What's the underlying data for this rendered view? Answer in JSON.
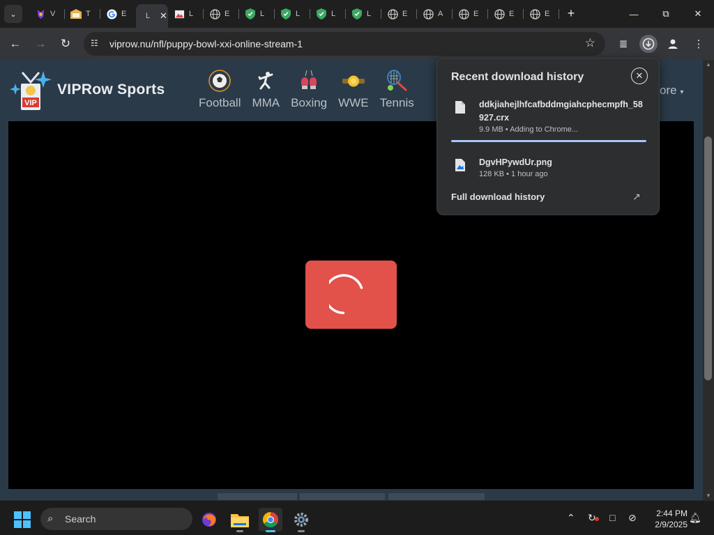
{
  "browser": {
    "tabs": [
      {
        "favicon": "purple-app-icon",
        "color": "#7b3fe4",
        "label": "V"
      },
      {
        "favicon": "gold-folder-icon",
        "color": "#e7b35b",
        "label": "T"
      },
      {
        "favicon": "google-icon",
        "color": "#ffffff",
        "label": "E"
      },
      {
        "favicon": "blank-tab-icon",
        "color": "#35363a",
        "label": "L",
        "active": true
      },
      {
        "favicon": "image-icon",
        "color": "#d44",
        "label": "L"
      },
      {
        "favicon": "globe-icon",
        "color": "#c4c7c5",
        "label": "E"
      },
      {
        "favicon": "shield-icon",
        "color": "#3da861",
        "label": "L"
      },
      {
        "favicon": "shield-icon",
        "color": "#3da861",
        "label": "L"
      },
      {
        "favicon": "shield-icon",
        "color": "#3da861",
        "label": "L"
      },
      {
        "favicon": "shield-icon",
        "color": "#3da861",
        "label": "L"
      },
      {
        "favicon": "globe-icon",
        "color": "#c4c7c5",
        "label": "E"
      },
      {
        "favicon": "globe-icon",
        "color": "#c4c7c5",
        "label": "A"
      },
      {
        "favicon": "globe-icon",
        "color": "#c4c7c5",
        "label": "E"
      },
      {
        "favicon": "globe-icon",
        "color": "#c4c7c5",
        "label": "E"
      },
      {
        "favicon": "globe-icon",
        "color": "#c4c7c5",
        "label": "E"
      }
    ],
    "url": "viprow.nu/nfl/puppy-bowl-xxi-online-stream-1"
  },
  "site": {
    "brand": "VIPRow Sports",
    "nav": [
      {
        "label": "Football",
        "icon": "football-icon"
      },
      {
        "label": "MMA",
        "icon": "fighter-icon"
      },
      {
        "label": "Boxing",
        "icon": "boxing-gloves-icon"
      },
      {
        "label": "WWE",
        "icon": "championship-belt-icon"
      },
      {
        "label": "Tennis",
        "icon": "tennis-icon"
      }
    ],
    "more_label": "ore"
  },
  "downloads": {
    "title": "Recent download history",
    "items": [
      {
        "name": "ddkjiahejlhfcafbddmgiahcphecmpfh_58927.crx",
        "meta": "9.9 MB • Adding to Chrome..."
      },
      {
        "name": "DgvHPywdUr.png",
        "meta": "128 KB • 1 hour ago"
      }
    ],
    "full_history_label": "Full download history"
  },
  "taskbar": {
    "search_placeholder": "Search",
    "time": "2:44 PM",
    "date": "2/9/2025"
  },
  "colors": {
    "page_bg": "#2b3a48",
    "loader_red": "#e2514a",
    "progress_blue": "#a8c7fa"
  }
}
